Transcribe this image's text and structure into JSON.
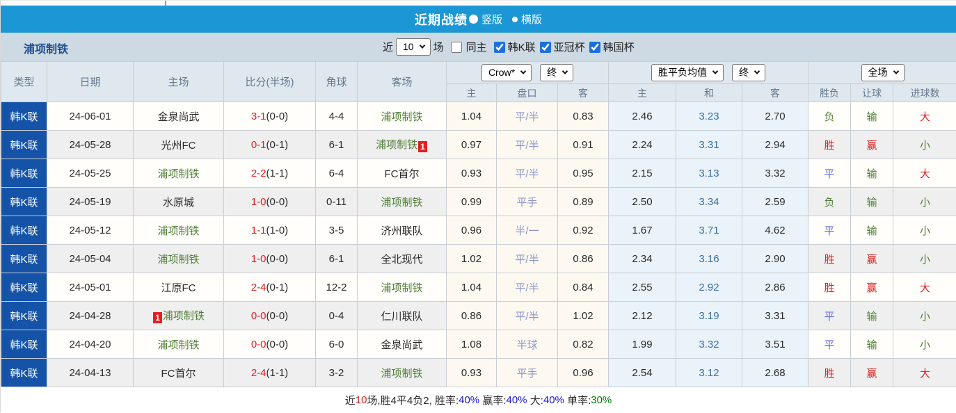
{
  "colors": {
    "title_bar_blue": "#1b97d5",
    "filter_bar_bg": "#cdd9e3",
    "header_bg": "#dfe8ef",
    "league_cell_blue": "#1553a8",
    "focus_team_green": "#4e7d35",
    "win_red": "#e02020",
    "draw_blue": "#5968ee",
    "draw_odds_blue": "#3a6fa5",
    "asian_odds_bg": "#fdf9f1",
    "avg_odds_bg": "#e9f3f9"
  },
  "title_bar": {
    "title": "近期战绩",
    "radio_vertical_label": "竖版",
    "radio_horizontal_label": "横版",
    "selected_layout": "竖版"
  },
  "filter_bar": {
    "team_name": "浦项制铁",
    "recent_label": "近",
    "recent_value": "10",
    "games_label": "场",
    "same_home_label": "同主",
    "same_home_checked": false,
    "leagues": [
      {
        "label": "韩K联",
        "checked": true
      },
      {
        "label": "亚冠杯",
        "checked": true
      },
      {
        "label": "韩国杯",
        "checked": true
      }
    ]
  },
  "table": {
    "main_columns": [
      "类型",
      "日期",
      "主场",
      "比分(半场)",
      "角球",
      "客场"
    ],
    "sub_columns": [
      "主",
      "盘口",
      "客",
      "主",
      "和",
      "客",
      "胜负",
      "让球",
      "进球数"
    ],
    "dropdowns": {
      "odds_source": "Crow*",
      "odds_time": "终",
      "avg_source": "胜平负均值",
      "avg_time": "终",
      "scope": "全场"
    },
    "rows": [
      {
        "league": "韩K联",
        "date": "24-06-01",
        "home": {
          "name": "金泉尚武",
          "green": false,
          "badge": null,
          "badge_pos": null
        },
        "score": "3-1",
        "half": "(0-0)",
        "corners": "4-4",
        "away": {
          "name": "浦项制铁",
          "green": true,
          "badge": null,
          "badge_pos": null
        },
        "asian": {
          "home": "1.04",
          "handicap": "平/半",
          "away": "0.83"
        },
        "avg": {
          "win": "2.46",
          "draw": "3.23",
          "lose": "2.70"
        },
        "result": {
          "text": "负",
          "color": "green"
        },
        "spread": {
          "text": "输",
          "color": "green"
        },
        "goals": {
          "text": "大",
          "color": "red"
        }
      },
      {
        "league": "韩K联",
        "date": "24-05-28",
        "home": {
          "name": "光州FC",
          "green": false,
          "badge": null,
          "badge_pos": null
        },
        "score": "0-1",
        "half": "(0-1)",
        "corners": "6-1",
        "away": {
          "name": "浦项制铁",
          "green": true,
          "badge": "1",
          "badge_pos": "after"
        },
        "asian": {
          "home": "0.97",
          "handicap": "平/半",
          "away": "0.91"
        },
        "avg": {
          "win": "2.24",
          "draw": "3.31",
          "lose": "2.94"
        },
        "result": {
          "text": "胜",
          "color": "red"
        },
        "spread": {
          "text": "赢",
          "color": "red"
        },
        "goals": {
          "text": "小",
          "color": "green"
        }
      },
      {
        "league": "韩K联",
        "date": "24-05-25",
        "home": {
          "name": "浦项制铁",
          "green": true,
          "badge": null,
          "badge_pos": null
        },
        "score": "2-2",
        "half": "(1-1)",
        "corners": "6-4",
        "away": {
          "name": "FC首尔",
          "green": false,
          "badge": null,
          "badge_pos": null
        },
        "asian": {
          "home": "0.93",
          "handicap": "平/半",
          "away": "0.95"
        },
        "avg": {
          "win": "2.15",
          "draw": "3.13",
          "lose": "3.32"
        },
        "result": {
          "text": "平",
          "color": "blue"
        },
        "spread": {
          "text": "输",
          "color": "green"
        },
        "goals": {
          "text": "大",
          "color": "red"
        }
      },
      {
        "league": "韩K联",
        "date": "24-05-19",
        "home": {
          "name": "水原城",
          "green": false,
          "badge": null,
          "badge_pos": null
        },
        "score": "1-0",
        "half": "(0-0)",
        "corners": "0-11",
        "away": {
          "name": "浦项制铁",
          "green": true,
          "badge": null,
          "badge_pos": null
        },
        "asian": {
          "home": "0.99",
          "handicap": "平手",
          "away": "0.89"
        },
        "avg": {
          "win": "2.50",
          "draw": "3.34",
          "lose": "2.59"
        },
        "result": {
          "text": "负",
          "color": "green"
        },
        "spread": {
          "text": "输",
          "color": "green"
        },
        "goals": {
          "text": "小",
          "color": "green"
        }
      },
      {
        "league": "韩K联",
        "date": "24-05-12",
        "home": {
          "name": "浦项制铁",
          "green": true,
          "badge": null,
          "badge_pos": null
        },
        "score": "1-1",
        "half": "(1-0)",
        "corners": "3-5",
        "away": {
          "name": "济州联队",
          "green": false,
          "badge": null,
          "badge_pos": null
        },
        "asian": {
          "home": "0.96",
          "handicap": "半/一",
          "away": "0.92"
        },
        "avg": {
          "win": "1.67",
          "draw": "3.71",
          "lose": "4.62"
        },
        "result": {
          "text": "平",
          "color": "blue"
        },
        "spread": {
          "text": "输",
          "color": "green"
        },
        "goals": {
          "text": "小",
          "color": "green"
        }
      },
      {
        "league": "韩K联",
        "date": "24-05-04",
        "home": {
          "name": "浦项制铁",
          "green": true,
          "badge": null,
          "badge_pos": null
        },
        "score": "1-0",
        "half": "(0-0)",
        "corners": "6-1",
        "away": {
          "name": "全北现代",
          "green": false,
          "badge": null,
          "badge_pos": null
        },
        "asian": {
          "home": "1.02",
          "handicap": "平/半",
          "away": "0.86"
        },
        "avg": {
          "win": "2.34",
          "draw": "3.16",
          "lose": "2.90"
        },
        "result": {
          "text": "胜",
          "color": "red"
        },
        "spread": {
          "text": "赢",
          "color": "red"
        },
        "goals": {
          "text": "小",
          "color": "green"
        }
      },
      {
        "league": "韩K联",
        "date": "24-05-01",
        "home": {
          "name": "江原FC",
          "green": false,
          "badge": null,
          "badge_pos": null
        },
        "score": "2-4",
        "half": "(0-1)",
        "corners": "12-2",
        "away": {
          "name": "浦项制铁",
          "green": true,
          "badge": null,
          "badge_pos": null
        },
        "asian": {
          "home": "1.04",
          "handicap": "平/半",
          "away": "0.84"
        },
        "avg": {
          "win": "2.55",
          "draw": "2.92",
          "lose": "2.86"
        },
        "result": {
          "text": "胜",
          "color": "red"
        },
        "spread": {
          "text": "赢",
          "color": "red"
        },
        "goals": {
          "text": "大",
          "color": "red"
        }
      },
      {
        "league": "韩K联",
        "date": "24-04-28",
        "home": {
          "name": "浦项制铁",
          "green": true,
          "badge": "1",
          "badge_pos": "before"
        },
        "score": "0-0",
        "half": "(0-0)",
        "corners": "0-4",
        "away": {
          "name": "仁川联队",
          "green": false,
          "badge": null,
          "badge_pos": null
        },
        "asian": {
          "home": "0.86",
          "handicap": "平/半",
          "away": "1.02"
        },
        "avg": {
          "win": "2.12",
          "draw": "3.19",
          "lose": "3.31"
        },
        "result": {
          "text": "平",
          "color": "blue"
        },
        "spread": {
          "text": "输",
          "color": "green"
        },
        "goals": {
          "text": "小",
          "color": "green"
        }
      },
      {
        "league": "韩K联",
        "date": "24-04-20",
        "home": {
          "name": "浦项制铁",
          "green": true,
          "badge": null,
          "badge_pos": null
        },
        "score": "0-0",
        "half": "(0-0)",
        "corners": "6-0",
        "away": {
          "name": "金泉尚武",
          "green": false,
          "badge": null,
          "badge_pos": null
        },
        "asian": {
          "home": "1.08",
          "handicap": "半球",
          "away": "0.82"
        },
        "avg": {
          "win": "1.99",
          "draw": "3.32",
          "lose": "3.51"
        },
        "result": {
          "text": "平",
          "color": "blue"
        },
        "spread": {
          "text": "输",
          "color": "green"
        },
        "goals": {
          "text": "小",
          "color": "green"
        }
      },
      {
        "league": "韩K联",
        "date": "24-04-13",
        "home": {
          "name": "FC首尔",
          "green": false,
          "badge": null,
          "badge_pos": null
        },
        "score": "2-4",
        "half": "(1-1)",
        "corners": "3-2",
        "away": {
          "name": "浦项制铁",
          "green": true,
          "badge": null,
          "badge_pos": null
        },
        "asian": {
          "home": "0.93",
          "handicap": "平手",
          "away": "0.96"
        },
        "avg": {
          "win": "2.54",
          "draw": "3.12",
          "lose": "2.68"
        },
        "result": {
          "text": "胜",
          "color": "red"
        },
        "spread": {
          "text": "赢",
          "color": "red"
        },
        "goals": {
          "text": "大",
          "color": "red"
        }
      }
    ]
  },
  "footer": {
    "segments": [
      {
        "text": "近",
        "color": "black"
      },
      {
        "text": "10",
        "color": "red"
      },
      {
        "text": "场,胜4平4负2, 胜率:",
        "color": "black"
      },
      {
        "text": "40%",
        "color": "blue"
      },
      {
        "text": " 赢率:",
        "color": "black"
      },
      {
        "text": "40%",
        "color": "blue"
      },
      {
        "text": " 大:",
        "color": "black"
      },
      {
        "text": "40%",
        "color": "blue"
      },
      {
        "text": " 单率:",
        "color": "black"
      },
      {
        "text": "30%",
        "color": "green"
      }
    ]
  }
}
